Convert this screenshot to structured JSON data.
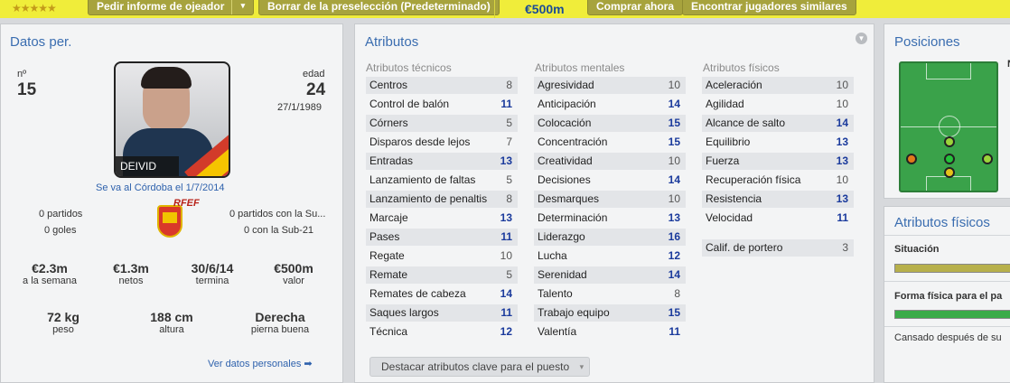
{
  "topbar": {
    "stars": "★★★★★",
    "scout_button": "Pedir informe de ojeador",
    "scout_arrow": "▾",
    "delete_button": "Borrar de la preselección (Predeterminado)",
    "price": "€500m",
    "buy_button": "Comprar ahora",
    "similar_button": "Encontrar jugadores similares"
  },
  "personal": {
    "title": "Datos per.",
    "number_label": "nº",
    "number": "15",
    "age_label": "edad",
    "age": "24",
    "birthdate": "27/1/1989",
    "player_name": "DEIVID",
    "transfer_note": "Se va al Córdoba el 1/7/2014",
    "matches": "0 partidos",
    "goals": "0 goles",
    "u21_matches": "0 partidos con la Su...",
    "u21_goals": "0 con la Sub-21",
    "federation_initials": "RFEF",
    "wage": "€2.3m",
    "wage_label": "a la semana",
    "net": "€1.3m",
    "net_label": "netos",
    "contract_end": "30/6/14",
    "contract_label": "termina",
    "value": "€500m",
    "value_label": "valor",
    "weight": "72 kg",
    "weight_label": "peso",
    "height": "188 cm",
    "height_label": "altura",
    "foot": "Derecha",
    "foot_label": "pierna buena",
    "details_link": "Ver datos personales ➡"
  },
  "attributes": {
    "title": "Atributos",
    "technical_header": "Atributos técnicos",
    "mental_header": "Atributos mentales",
    "physical_header": "Atributos físicos",
    "technical": [
      {
        "name": "Centros",
        "value": "8"
      },
      {
        "name": "Control de balón",
        "value": "11"
      },
      {
        "name": "Córners",
        "value": "5"
      },
      {
        "name": "Disparos desde lejos",
        "value": "7"
      },
      {
        "name": "Entradas",
        "value": "13"
      },
      {
        "name": "Lanzamiento de faltas",
        "value": "5"
      },
      {
        "name": "Lanzamiento de penaltis",
        "value": "8"
      },
      {
        "name": "Marcaje",
        "value": "13"
      },
      {
        "name": "Pases",
        "value": "11"
      },
      {
        "name": "Regate",
        "value": "10"
      },
      {
        "name": "Remate",
        "value": "5"
      },
      {
        "name": "Remates de cabeza",
        "value": "14"
      },
      {
        "name": "Saques largos",
        "value": "11"
      },
      {
        "name": "Técnica",
        "value": "12"
      }
    ],
    "mental": [
      {
        "name": "Agresividad",
        "value": "10"
      },
      {
        "name": "Anticipación",
        "value": "14"
      },
      {
        "name": "Colocación",
        "value": "15"
      },
      {
        "name": "Concentración",
        "value": "15"
      },
      {
        "name": "Creatividad",
        "value": "10"
      },
      {
        "name": "Decisiones",
        "value": "14"
      },
      {
        "name": "Desmarques",
        "value": "10"
      },
      {
        "name": "Determinación",
        "value": "13"
      },
      {
        "name": "Liderazgo",
        "value": "16"
      },
      {
        "name": "Lucha",
        "value": "12"
      },
      {
        "name": "Serenidad",
        "value": "14"
      },
      {
        "name": "Talento",
        "value": "8"
      },
      {
        "name": "Trabajo equipo",
        "value": "15"
      },
      {
        "name": "Valentía",
        "value": "11"
      }
    ],
    "physical": [
      {
        "name": "Aceleración",
        "value": "10"
      },
      {
        "name": "Agilidad",
        "value": "10"
      },
      {
        "name": "Alcance de salto",
        "value": "14"
      },
      {
        "name": "Equilibrio",
        "value": "13"
      },
      {
        "name": "Fuerza",
        "value": "13"
      },
      {
        "name": "Recuperación física",
        "value": "10"
      },
      {
        "name": "Resistencia",
        "value": "13"
      },
      {
        "name": "Velocidad",
        "value": "11"
      }
    ],
    "goalkeeper": {
      "name": "Calif. de portero",
      "value": "3"
    },
    "highlight_button": "Destacar atributos clave para el puesto",
    "highlight_arrow": "▾"
  },
  "positions": {
    "title": "Posiciones",
    "edge_text": "N"
  },
  "physical_panel": {
    "title": "Atributos físicos",
    "condition_label": "Situación",
    "fitness_label": "Forma física para el pa",
    "fatigue_label": "Cansado después de su",
    "colors": {
      "condition": "#b7b04b",
      "fitness": "#3bab49"
    }
  }
}
